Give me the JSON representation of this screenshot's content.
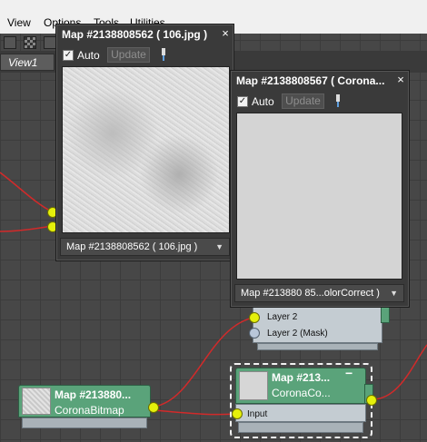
{
  "menubar": {
    "items": [
      "View",
      "Options",
      "Tools",
      "Utilities"
    ]
  },
  "viewport": {
    "tab": "View1"
  },
  "window_left": {
    "title": "Map #2138808562 ( 106.jpg )",
    "auto_label": "Auto",
    "auto_checked": true,
    "update_label": "Update",
    "dropdown": "Map #2138808562 ( 106.jpg )",
    "close": "×"
  },
  "window_right": {
    "title": "Map #2138808567  ( Corona...",
    "auto_label": "Auto",
    "auto_checked": true,
    "update_label": "Update",
    "dropdown": "Map #213880 85...olorCorrect )",
    "close": "×"
  },
  "node_bitmap": {
    "line1": "Map #213880...",
    "line2": "CoronaBitmap"
  },
  "node_colorcorrect": {
    "line1": "Map #213...",
    "line2": "CoronaCo...",
    "input_label": "Input",
    "collapse": "−"
  },
  "node_layered": {
    "layer2": "Layer 2",
    "layer2_mask": "Layer 2 (Mask)"
  },
  "colors": {
    "node_header": "#5aa37a",
    "wire": "#d22a2a",
    "socket": "#e5f00b",
    "node_body": "#c4ccd2"
  }
}
